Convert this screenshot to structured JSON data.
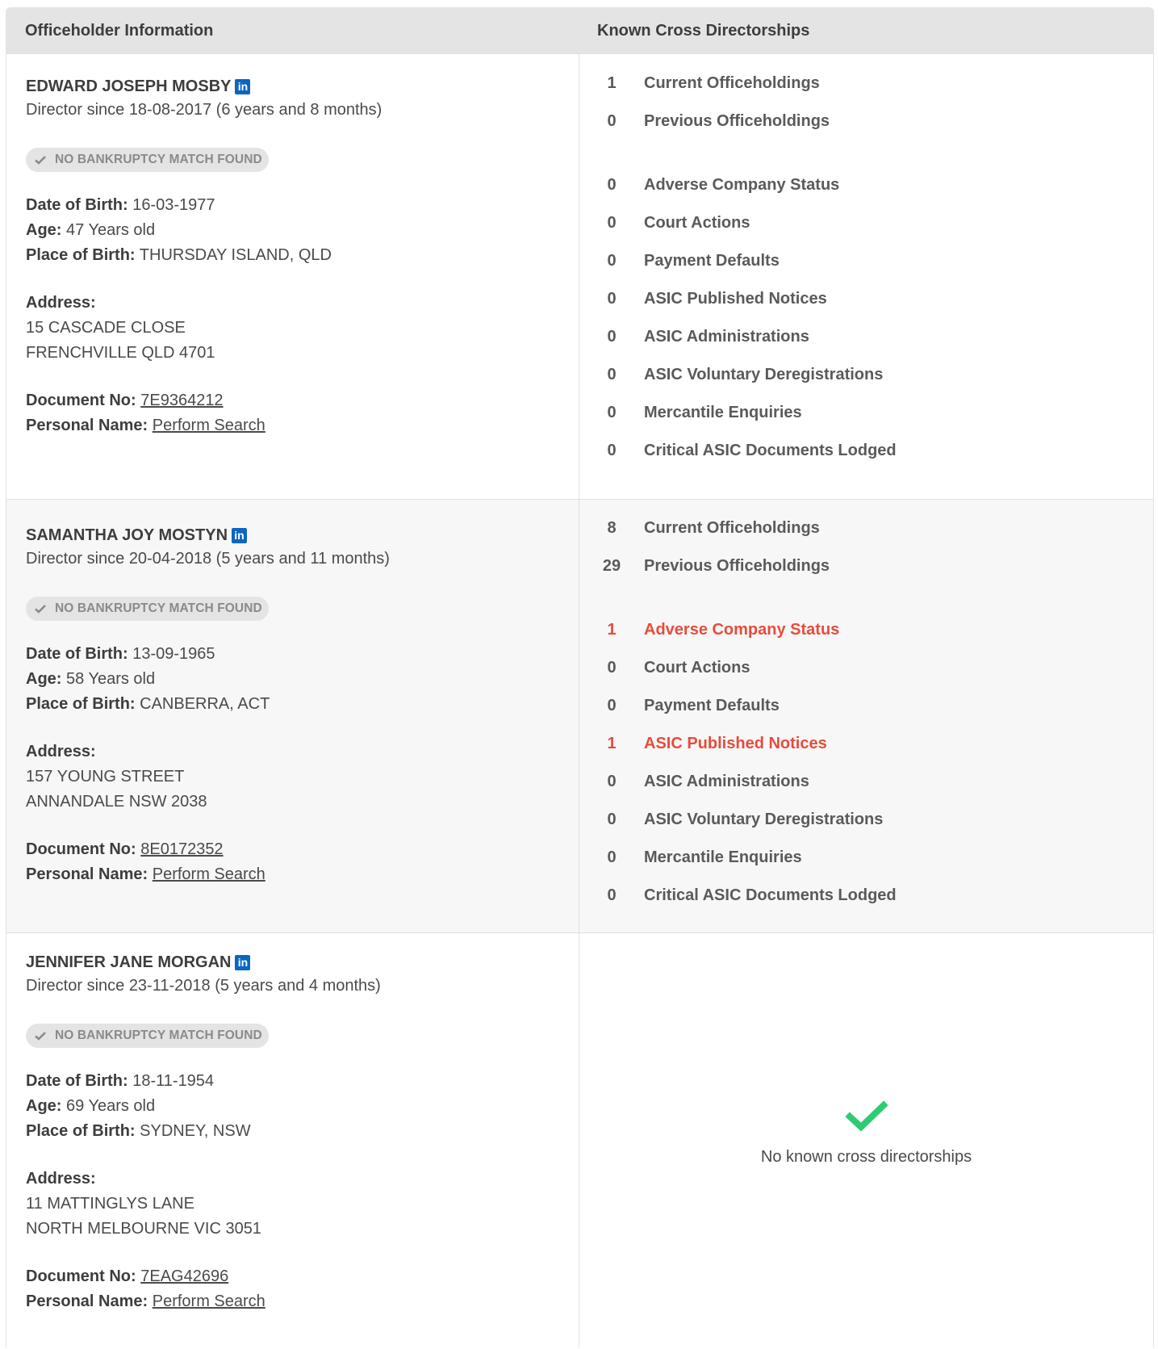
{
  "header": {
    "left": "Officeholder Information",
    "right": "Known Cross Directorships"
  },
  "labels": {
    "dob": "Date of Birth:",
    "age": "Age:",
    "pob": "Place of Birth:",
    "address": "Address:",
    "doc": "Document No:",
    "personal": "Personal Name:",
    "badge": "NO BANKRUPTCY MATCH FOUND",
    "perform_search": "Perform Search",
    "linkedin": "in",
    "no_cross": "No known cross directorships"
  },
  "colors": {
    "alert": "#e74c3c",
    "linkedin": "#0a66c2",
    "success": "#2ecc71"
  },
  "officers": [
    {
      "name": "EDWARD JOSEPH MOSBY",
      "since": "Director since 18-08-2017 (6 years and 8 months)",
      "dob": "16-03-1977",
      "age": "47 Years old",
      "pob": "THURSDAY ISLAND, QLD",
      "address1": "15 CASCADE CLOSE",
      "address2": "FRENCHVILLE QLD 4701",
      "doc": "7E9364212",
      "stats": {
        "current": {
          "num": "1",
          "label": "Current Officeholdings"
        },
        "previous": {
          "num": "0",
          "label": "Previous Officeholdings"
        },
        "adverse": {
          "num": "0",
          "label": "Adverse Company Status"
        },
        "court": {
          "num": "0",
          "label": "Court Actions"
        },
        "payment": {
          "num": "0",
          "label": "Payment Defaults"
        },
        "notices": {
          "num": "0",
          "label": "ASIC Published Notices"
        },
        "admin": {
          "num": "0",
          "label": "ASIC Administrations"
        },
        "dereg": {
          "num": "0",
          "label": "ASIC Voluntary Deregistrations"
        },
        "mercantile": {
          "num": "0",
          "label": "Mercantile Enquiries"
        },
        "critical": {
          "num": "0",
          "label": "Critical ASIC Documents Lodged"
        }
      }
    },
    {
      "name": "SAMANTHA JOY MOSTYN",
      "since": "Director since 20-04-2018 (5 years and 11 months)",
      "dob": "13-09-1965",
      "age": "58 Years old",
      "pob": "CANBERRA, ACT",
      "address1": "157 YOUNG STREET",
      "address2": "ANNANDALE NSW 2038",
      "doc": "8E0172352",
      "stats": {
        "current": {
          "num": "8",
          "label": "Current Officeholdings"
        },
        "previous": {
          "num": "29",
          "label": "Previous Officeholdings"
        },
        "adverse": {
          "num": "1",
          "label": "Adverse Company Status"
        },
        "court": {
          "num": "0",
          "label": "Court Actions"
        },
        "payment": {
          "num": "0",
          "label": "Payment Defaults"
        },
        "notices": {
          "num": "1",
          "label": "ASIC Published Notices"
        },
        "admin": {
          "num": "0",
          "label": "ASIC Administrations"
        },
        "dereg": {
          "num": "0",
          "label": "ASIC Voluntary Deregistrations"
        },
        "mercantile": {
          "num": "0",
          "label": "Mercantile Enquiries"
        },
        "critical": {
          "num": "0",
          "label": "Critical ASIC Documents Lodged"
        }
      }
    },
    {
      "name": "JENNIFER JANE MORGAN",
      "since": "Director since 23-11-2018 (5 years and 4 months)",
      "dob": "18-11-1954",
      "age": "69 Years old",
      "pob": "SYDNEY, NSW",
      "address1": "11 MATTINGLYS LANE",
      "address2": "NORTH MELBOURNE VIC 3051",
      "doc": "7EAG42696"
    }
  ]
}
